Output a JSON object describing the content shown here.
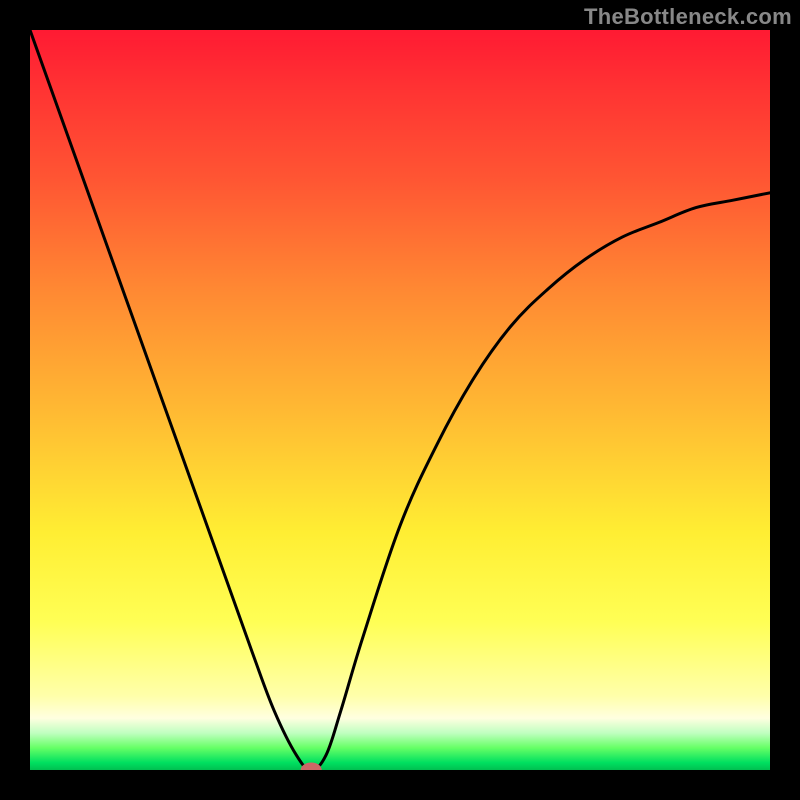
{
  "watermark": "TheBottleneck.com",
  "chart_data": {
    "type": "line",
    "title": "",
    "xlabel": "",
    "ylabel": "",
    "xlim": [
      0,
      100
    ],
    "ylim": [
      0,
      100
    ],
    "grid": false,
    "legend": false,
    "background": "rainbow-gradient-red-to-green",
    "series": [
      {
        "name": "bottleneck-curve",
        "x": [
          0,
          5,
          10,
          15,
          20,
          25,
          30,
          33,
          36,
          38,
          40,
          42,
          45,
          50,
          55,
          60,
          65,
          70,
          75,
          80,
          85,
          90,
          95,
          100
        ],
        "y": [
          100,
          86,
          72,
          58,
          44,
          30,
          16,
          8,
          2,
          0,
          2,
          8,
          18,
          33,
          44,
          53,
          60,
          65,
          69,
          72,
          74,
          76,
          77,
          78
        ]
      }
    ],
    "marker": {
      "x": 38,
      "y": 0,
      "shape": "pill",
      "color": "#cc6666"
    }
  }
}
